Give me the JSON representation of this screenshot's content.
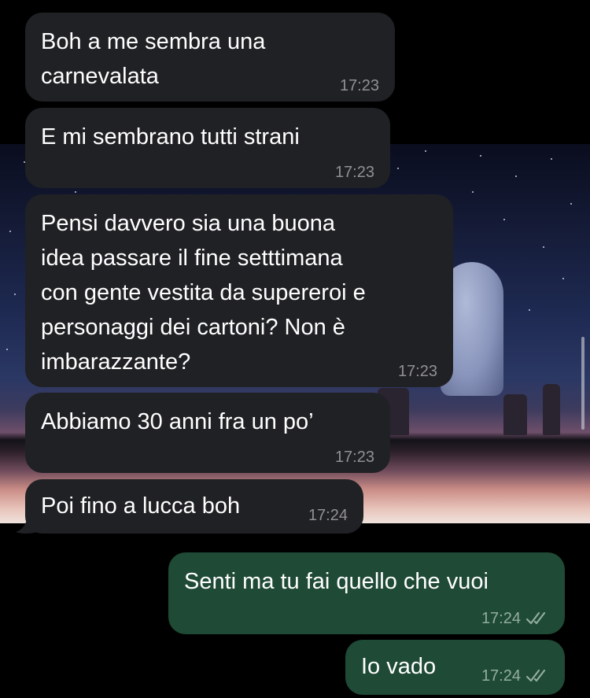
{
  "messages": [
    {
      "direction": "in",
      "text": "Boh a me sembra una\ncarnevalata",
      "time": "17:23"
    },
    {
      "direction": "in",
      "text": "E mi sembrano tutti strani",
      "time": "17:23"
    },
    {
      "direction": "in",
      "text": "Pensi davvero sia una buona\nidea passare il fine setttimana\ncon gente vestita da supereroi e\npersonaggi dei cartoni? Non è\nimbarazzante?",
      "time": "17:23"
    },
    {
      "direction": "in",
      "text": "Abbiamo 30 anni fra un po’",
      "time": "17:23"
    },
    {
      "direction": "in",
      "text": "Poi fino a lucca boh",
      "time": "17:24"
    },
    {
      "direction": "out",
      "text": "Senti ma tu fai quello che vuoi",
      "time": "17:24",
      "status_icon": "double-check-icon"
    },
    {
      "direction": "out",
      "text": "Io vado",
      "time": "17:24",
      "status_icon": "double-check-icon"
    }
  ],
  "colors": {
    "background": "#000000",
    "incoming_bubble": "#202124",
    "outgoing_bubble": "#1f4a36",
    "text": "#ffffff"
  }
}
